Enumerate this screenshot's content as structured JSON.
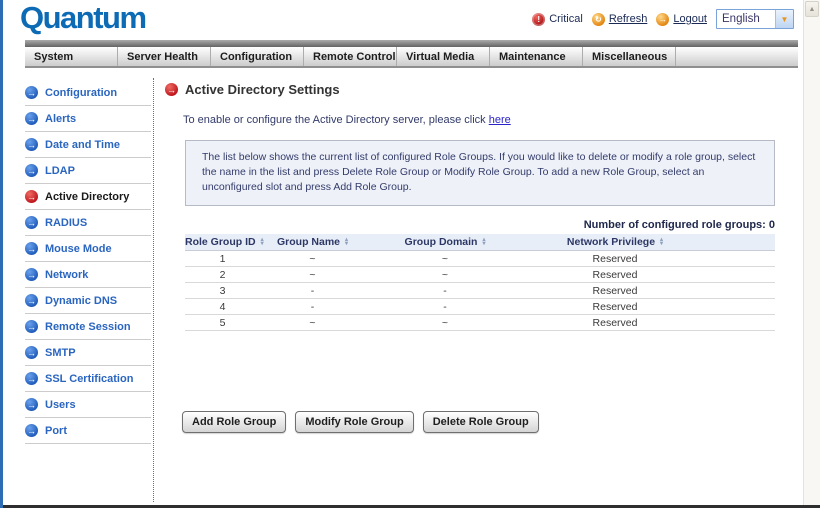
{
  "header": {
    "logo": "Quantum",
    "critical_label": "Critical",
    "refresh_label": "Refresh",
    "logout_label": "Logout",
    "language_selected": "English"
  },
  "nav": {
    "tabs": [
      "System",
      "Server Health",
      "Configuration",
      "Remote Control",
      "Virtual Media",
      "Maintenance",
      "Miscellaneous"
    ]
  },
  "sidebar": {
    "items": [
      {
        "label": "Configuration",
        "active": false
      },
      {
        "label": "Alerts",
        "active": false
      },
      {
        "label": "Date and Time",
        "active": false
      },
      {
        "label": "LDAP",
        "active": false
      },
      {
        "label": "Active Directory",
        "active": true
      },
      {
        "label": "RADIUS",
        "active": false
      },
      {
        "label": "Mouse Mode",
        "active": false
      },
      {
        "label": "Network",
        "active": false
      },
      {
        "label": "Dynamic DNS",
        "active": false
      },
      {
        "label": "Remote Session",
        "active": false
      },
      {
        "label": "SMTP",
        "active": false
      },
      {
        "label": "SSL Certification",
        "active": false
      },
      {
        "label": "Users",
        "active": false
      },
      {
        "label": "Port",
        "active": false
      }
    ]
  },
  "main": {
    "title": "Active Directory Settings",
    "intro_prefix": "To enable or configure the Active Directory server, please click ",
    "intro_link_label": "here",
    "info_text": "The list below shows the current list of configured Role Groups. If you would like to delete or modify a role group, select the name in the list and press Delete Role Group or Modify Role Group. To add a new Role Group, select an unconfigured slot and press Add Role Group.",
    "count_label": "Number of configured role groups: 0",
    "table": {
      "columns": [
        "Role Group ID",
        "Group Name",
        "Group Domain",
        "Network Privilege"
      ],
      "rows": [
        [
          "1",
          "~",
          "~",
          "Reserved"
        ],
        [
          "2",
          "~",
          "~",
          "Reserved"
        ],
        [
          "3",
          "-",
          "-",
          "Reserved"
        ],
        [
          "4",
          "-",
          "-",
          "Reserved"
        ],
        [
          "5",
          "~",
          "~",
          "Reserved"
        ]
      ]
    },
    "buttons": [
      "Add Role Group",
      "Modify Role Group",
      "Delete Role Group"
    ]
  },
  "colors": {
    "logo_blue": "#0d6bb5",
    "header_link_navy": "#1b2a55",
    "sidebar_link_blue": "#2a65c0",
    "active_icon_red": "#bb1019",
    "icon_blue": "#1a58b6",
    "icon_orange": "#e07f06",
    "table_header_bg": "#e8eef7",
    "infobox_bg": "#eef1f8",
    "left_border_blue": "#2e6cb5"
  }
}
